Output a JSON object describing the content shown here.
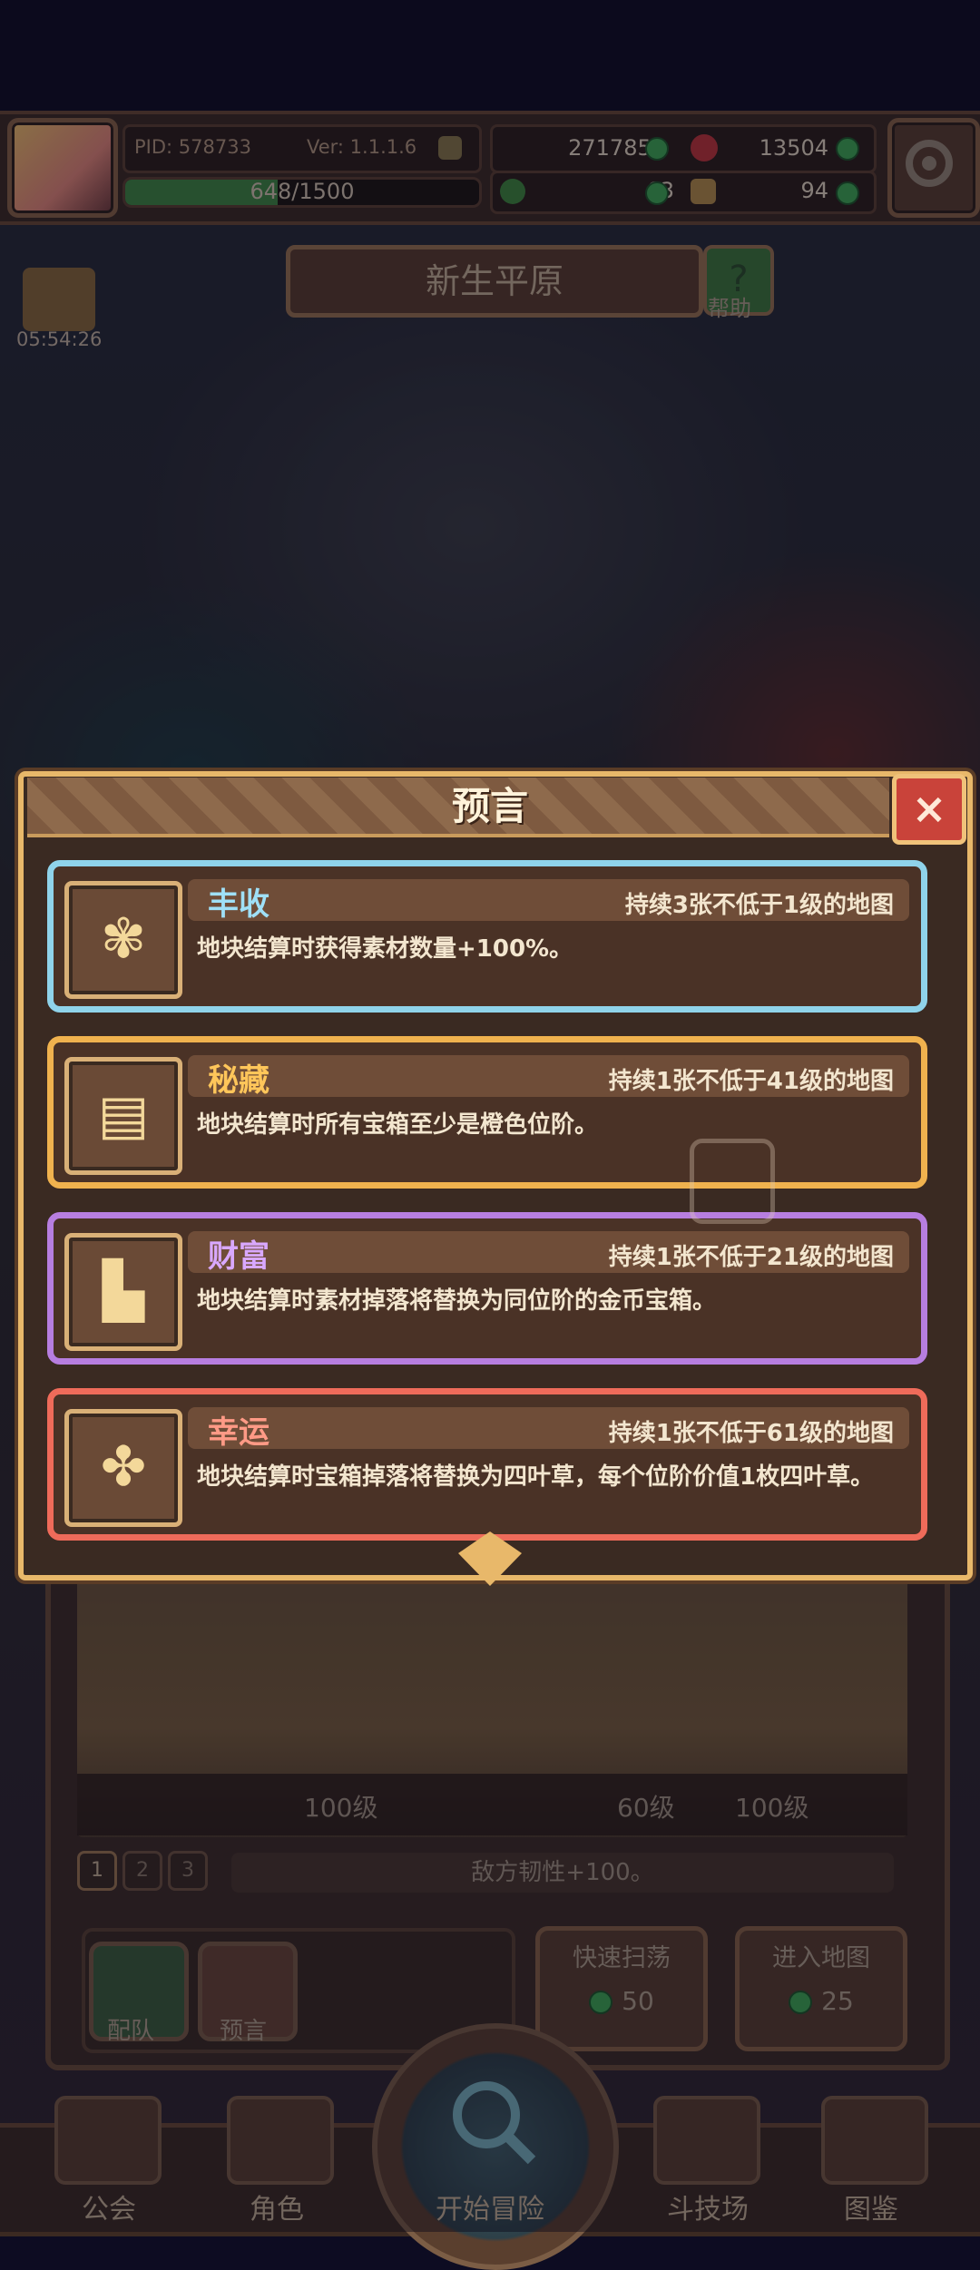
{
  "topbar": {
    "pid": "PID: 578733",
    "version": "Ver: 1.1.1.6",
    "gold": "2717852",
    "ruby": "13504",
    "xp": "648/1500",
    "xp_progress": 0.432,
    "clover": "63",
    "material": "94"
  },
  "map": {
    "title": "新生平原",
    "help_icon": "?",
    "help_label": "帮助",
    "gift_timer": "05:54:26"
  },
  "modal": {
    "title": "预言",
    "close_icon": "×",
    "cards": [
      {
        "name": "丰收",
        "condition": "持续3张不低于1级的地图",
        "desc": "地块结算时获得素材数量+100%。",
        "icon": "wheat-icon",
        "color": "#8fd3ea"
      },
      {
        "name": "秘藏",
        "condition": "持续1张不低于41级的地图",
        "desc": "地块结算时所有宝箱至少是橙色位阶。",
        "icon": "scroll-icon",
        "color": "#f0b24e"
      },
      {
        "name": "财富",
        "condition": "持续1张不低于21级的地图",
        "desc": "地块结算时素材掉落将替换为同位阶的金币宝箱。",
        "icon": "coins-icon",
        "color": "#b77ee0"
      },
      {
        "name": "幸运",
        "condition": "持续1张不低于61级的地图",
        "desc": "地块结算时宝箱掉落将替换为四叶草，每个位阶价值1枚四叶草。",
        "icon": "clover-icon",
        "color": "#ef6b5a"
      }
    ]
  },
  "battle": {
    "level_left": "100级",
    "level_mid": "60级",
    "level_right": "100级",
    "tabs": [
      "1",
      "2",
      "3"
    ],
    "effect_text": "敌方韧性+100。"
  },
  "actions": {
    "team_label": "配队",
    "prophecy_label": "预言",
    "sweep_label": "快速扫荡",
    "sweep_cost": "50",
    "enter_label": "进入地图",
    "enter_cost": "25"
  },
  "nav": {
    "guild": "公会",
    "character": "角色",
    "start": "开始冒险",
    "arena": "斗技场",
    "codex": "图鉴"
  }
}
